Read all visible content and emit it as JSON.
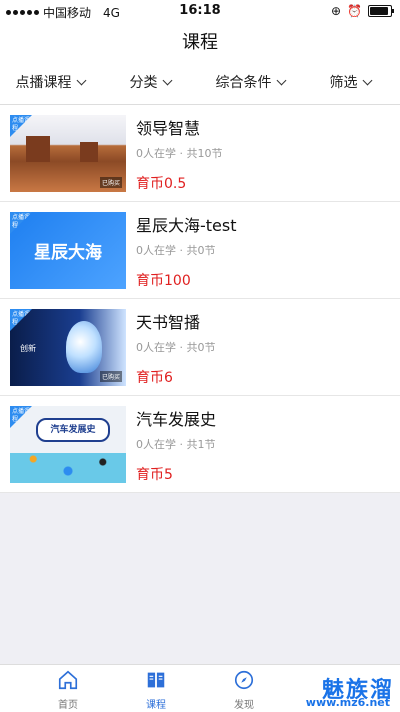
{
  "status": {
    "carrier": "中国移动",
    "network": "4G",
    "time": "16:18"
  },
  "header": {
    "title": "课程"
  },
  "filters": [
    {
      "label": "点播课程"
    },
    {
      "label": "分类"
    },
    {
      "label": "综合条件"
    },
    {
      "label": "筛选"
    }
  ],
  "badge_text": "点播课程",
  "courses": [
    {
      "title": "领导智慧",
      "meta": "0人在学 · 共10节",
      "price": "育币0.5",
      "tag": "已购买"
    },
    {
      "title": "星辰大海-test",
      "meta": "0人在学 · 共0节",
      "price": "育币100",
      "thumb_text": "星辰大海"
    },
    {
      "title": "天书智播",
      "meta": "0人在学 · 共0节",
      "price": "育币6",
      "thumb_text": "创新",
      "tag": "已购买"
    },
    {
      "title": "汽车发展史",
      "meta": "0人在学 · 共1节",
      "price": "育币5",
      "thumb_text": "汽车发展史"
    }
  ],
  "tabs": [
    {
      "label": "首页",
      "icon": "home-icon"
    },
    {
      "label": "课程",
      "icon": "book-icon"
    },
    {
      "label": "发现",
      "icon": "compass-icon"
    }
  ],
  "watermark": {
    "text": "魅族溜",
    "url": "www.mz6.net"
  },
  "colors": {
    "accent": "#2d6fd8",
    "price": "#e02020"
  }
}
